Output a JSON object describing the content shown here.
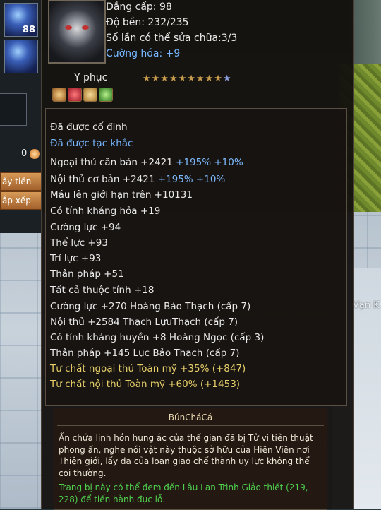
{
  "item": {
    "level_line": "Đẳng cấp: 98",
    "durability_line": "Độ bền: 232/235",
    "repairs_line": "Số lần có thể sửa chữa:3/3",
    "enhance_line": "Cường hóa: +9",
    "quality_label": "Y phục",
    "stars_filled": 9,
    "stars_total": 10,
    "stars_filled_text": "★★★★★★★★★",
    "stars_empty_text": "★"
  },
  "attributes": {
    "fixed": "Đã được cố định",
    "engraved": "Đã được tạc khắc",
    "lines": [
      {
        "text": "Ngoại thủ căn bản +2421",
        "extra": " +195% +10%"
      },
      {
        "text": "Nội thủ cơ bản +2421",
        "extra": " +195% +10%"
      },
      {
        "text": "Máu lên giới hạn trên +10131",
        "extra": ""
      },
      {
        "text": "Có tính kháng hỏa +19",
        "extra": ""
      },
      {
        "text": "Cường lực +94",
        "extra": ""
      },
      {
        "text": "Thể lực +93",
        "extra": ""
      },
      {
        "text": "Trí lực +93",
        "extra": ""
      },
      {
        "text": "Thân pháp +51",
        "extra": ""
      },
      {
        "text": "Tất cả thuộc tính +18",
        "extra": ""
      },
      {
        "text": "Cường lực +270 Hoàng Bảo Thạch (cấp 7)",
        "extra": ""
      },
      {
        "text": "Nội thủ +2584 Thạch LựuThạch (cấp 7)",
        "extra": ""
      },
      {
        "text": "Có tính kháng huyền +8 Hoàng Ngọc (cấp 3)",
        "extra": ""
      },
      {
        "text": "Thân pháp +145 Lục Bảo Thạch (cấp 7)",
        "extra": ""
      }
    ],
    "aptitude": [
      "Tư chất ngoại thủ  Toàn mỹ +35% (+847)",
      "Tư chất nội thủ  Toàn mỹ +60% (+1453)"
    ]
  },
  "description": {
    "owner": "BúnChảCá",
    "lore": "Ẩn chứa linh hồn hung ác của thế gian đã bị Tử vi tiên thuật phong ấn, nghe nói vật này thuộc sở hữu của Hiên Viên nơi Thiện giới, lấy da của loan giao chế thành uy lực không thể coi thường.",
    "hint": "Trang bị này có thể đem đến Lâu Lan Trình Giảo thiết (219, 228) để tiến hành đục lỗ."
  },
  "hud": {
    "skill_count": "88",
    "coin_value": "0",
    "btn_1": "ấy tiền",
    "btn_2": "ắp xếp"
  },
  "scene": {
    "far_label": "Vạn K"
  }
}
